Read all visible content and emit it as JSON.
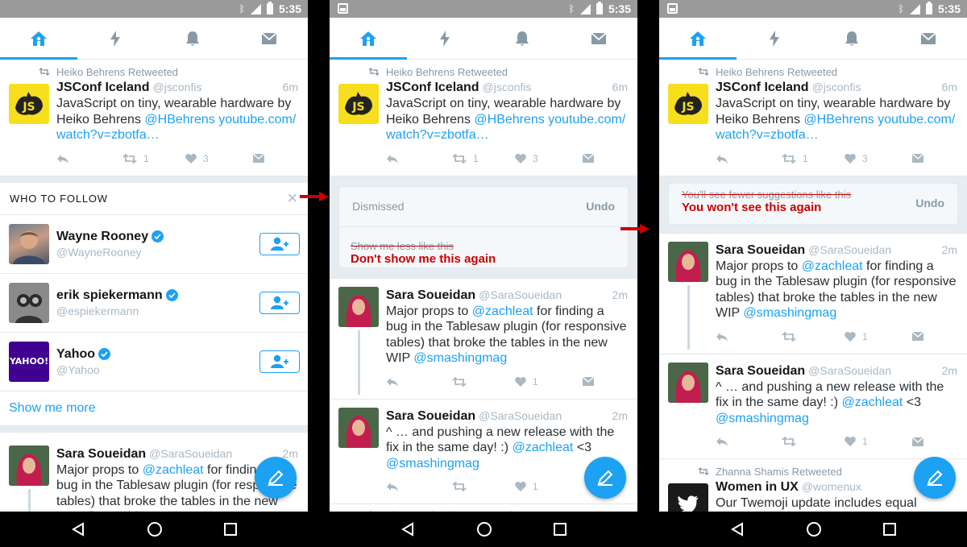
{
  "statusbar": {
    "time": "5:35"
  },
  "tabs": [
    {
      "name": "home",
      "active": true
    },
    {
      "name": "moments"
    },
    {
      "name": "notifications"
    },
    {
      "name": "messages"
    }
  ],
  "tweets": {
    "jsconf": {
      "retweeted_by": "Heiko Behrens Retweeted",
      "name": "JSConf Iceland",
      "handle": "@jsconfis",
      "time": "6m",
      "text_1": "JavaScript on tiny, wearable hardware by Heiko Behrens ",
      "link_1": "@HBehrens",
      "link_2": "youtube.com/ watch?v=zbotfa…",
      "retweets": "1",
      "likes": "3"
    },
    "sara1": {
      "name": "Sara Soueidan",
      "handle": "@SaraSoueidan",
      "time": "2m",
      "text_1": "Major props to ",
      "link_1": "@zachleat",
      "text_2": " for finding a bug in the Tablesaw plugin (for responsive tables) that broke the tables in the new WIP ",
      "link_2": "@smashingmag",
      "likes": "1"
    },
    "sara2": {
      "name": "Sara Soueidan",
      "handle": "@SaraSoueidan",
      "time": "2m",
      "text_1": "^ … and pushing a new release with the fix in the same day! :) ",
      "link_1": "@zachleat",
      "text_2": " <3 ",
      "link_2": "@smashingmag",
      "likes": "1"
    },
    "women_ux": {
      "retweeted_by": "Zhanna Shamis Retweeted",
      "name": "Women in UX",
      "handle": "@womenux",
      "text": "Our Twemoji update includes equal representation of women & men in a variety of"
    }
  },
  "who_to_follow": {
    "title": "WHO TO FOLLOW",
    "close": "×",
    "accounts": [
      {
        "name": "Wayne Rooney",
        "handle": "@WayneRooney"
      },
      {
        "name": "erik spiekermann",
        "handle": "@espiekermann"
      },
      {
        "name": "Yahoo",
        "handle": "@Yahoo",
        "avatar_text": "YAHOO!"
      }
    ],
    "show_more": "Show me more"
  },
  "dismiss_panel": {
    "label": "Dismissed",
    "undo": "Undo",
    "struck_option": "Show me less like this",
    "annotation": "Don't show me this again"
  },
  "dismiss_panel_2": {
    "struck_text": "You'll see fewer suggestions like this",
    "undo": "Undo",
    "annotation": "You won't see this again"
  },
  "colors": {
    "accent": "#1da1f2",
    "annotation_red": "#cc0000",
    "statusbar": "#9a9a9a"
  }
}
